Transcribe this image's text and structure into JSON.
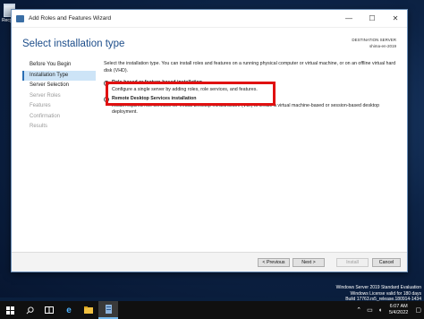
{
  "desktop": {
    "recycle_label": "Recy",
    "watermark": [
      "Windows Server 2019 Standard Evaluation",
      "Windows License valid for 180 days",
      "Build 17763.rs5_release.180914-1434"
    ]
  },
  "window": {
    "title": "Add Roles and Features Wizard",
    "controls": {
      "minimize": "—",
      "maximize": "☐",
      "close": "✕"
    },
    "page_title": "Select installation type",
    "destination_label": "DESTINATION SERVER",
    "destination_server": "shima-en-2019"
  },
  "sidebar": {
    "items": [
      {
        "label": "Before You Begin",
        "state": "normal"
      },
      {
        "label": "Installation Type",
        "state": "active"
      },
      {
        "label": "Server Selection",
        "state": "normal"
      },
      {
        "label": "Server Roles",
        "state": "disabled"
      },
      {
        "label": "Features",
        "state": "disabled"
      },
      {
        "label": "Confirmation",
        "state": "disabled"
      },
      {
        "label": "Results",
        "state": "disabled"
      }
    ]
  },
  "content": {
    "description": "Select the installation type. You can install roles and features on a running physical computer or virtual machine, or on an offline virtual hard disk (VHD).",
    "options": [
      {
        "title": "Role-based or feature-based installation",
        "text": "Configure a single server by adding roles, role services, and features.",
        "selected": true
      },
      {
        "title": "Remote Desktop Services installation",
        "text": "Install required role services for Virtual Desktop Infrastructure (VDI) to create a virtual machine-based or session-based desktop deployment.",
        "selected": false
      }
    ]
  },
  "footer": {
    "previous": "< Previous",
    "next": "Next >",
    "install": "Install",
    "cancel": "Cancel"
  },
  "taskbar": {
    "time": "6:07 AM",
    "date": "5/4/2022",
    "icons": [
      "windows-start",
      "search",
      "task-view",
      "internet-explorer",
      "file-explorer",
      "server-manager"
    ]
  },
  "colors": {
    "accent": "#1c4d8a",
    "highlight_border": "#e01111",
    "sidebar_active": "#cde4f7"
  }
}
